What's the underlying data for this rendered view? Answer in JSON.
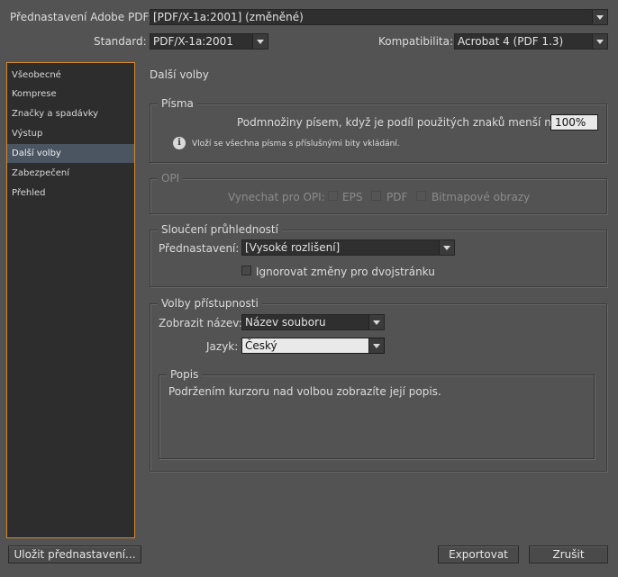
{
  "header": {
    "preset_label": "Přednastavení Adobe PDF:",
    "preset_value": "[PDF/X-1a:2001] (změněné)",
    "standard_label": "Standard:",
    "standard_value": "PDF/X-1a:2001",
    "compat_label": "Kompatibilita:",
    "compat_value": "Acrobat 4 (PDF 1.3)"
  },
  "sidebar": {
    "items": [
      {
        "label": "Všeobecné"
      },
      {
        "label": "Komprese"
      },
      {
        "label": "Značky a spadávky"
      },
      {
        "label": "Výstup"
      },
      {
        "label": "Další volby"
      },
      {
        "label": "Zabezpečení"
      },
      {
        "label": "Přehled"
      }
    ],
    "selected_index": 4
  },
  "panel": {
    "title": "Další volby",
    "fonts": {
      "title": "Písma",
      "subset_label": "Podmnožiny písem, když je podíl použitých znaků menší než:",
      "subset_value": "100%",
      "info_text": "Vloží se všechna písma s  příslušnými bity vkládání."
    },
    "opi": {
      "title": "OPI",
      "omit_label": "Vynechat pro OPI:",
      "eps_label": "EPS",
      "pdf_label": "PDF",
      "bitmap_label": "Bitmapové obrazy"
    },
    "flattening": {
      "title": "Sloučení průhledností",
      "preset_label": "Přednastavení:",
      "preset_value": "[Vysoké rozlišení]",
      "ignore_label": "Ignorovat změny pro dvojstránku"
    },
    "accessibility": {
      "title": "Volby přístupnosti",
      "display_title_label": "Zobrazit název:",
      "display_title_value": "Název souboru",
      "language_label": "Jazyk:",
      "language_value": "Český"
    },
    "description": {
      "title": "Popis",
      "text": "Podržením kurzoru nad volbou zobrazíte její popis."
    }
  },
  "footer": {
    "save_preset_label": "Uložit přednastavení...",
    "export_label": "Exportovat",
    "cancel_label": "Zrušit"
  }
}
